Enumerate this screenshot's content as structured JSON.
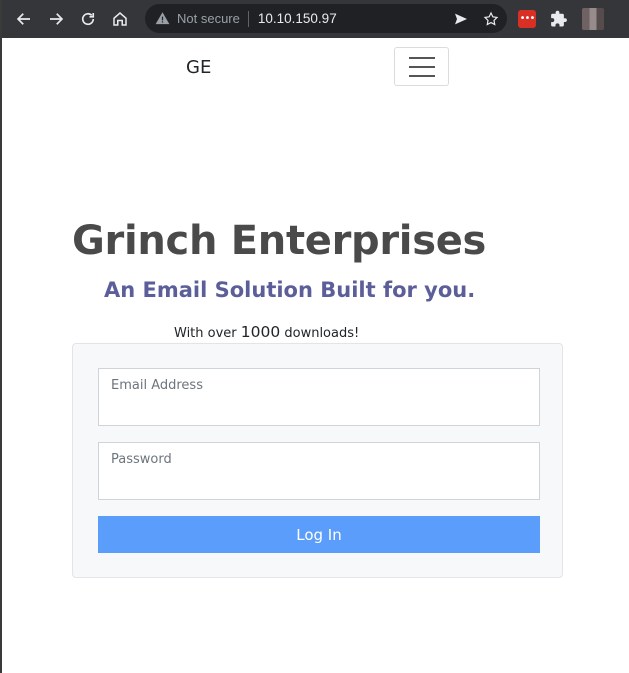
{
  "browser": {
    "security_label": "Not secure",
    "url": "10.10.150.97"
  },
  "navbar": {
    "brand": "GE"
  },
  "hero": {
    "title": "Grinch Enterprises",
    "subtitle": "An Email Solution Built for you.",
    "downloads_prefix": "With over ",
    "downloads_count": "1000",
    "downloads_suffix": " downloads!"
  },
  "login_form": {
    "email_label": "Email Address",
    "email_value": "",
    "password_label": "Password",
    "password_value": "",
    "submit_label": "Log In"
  },
  "colors": {
    "toolbar_bg": "#35363a",
    "omnibox_bg": "#202124",
    "title": "#4a4a4a",
    "subtitle": "#5c5e9a",
    "button_bg": "#5b9dfa",
    "card_bg": "#f7f8fa"
  }
}
